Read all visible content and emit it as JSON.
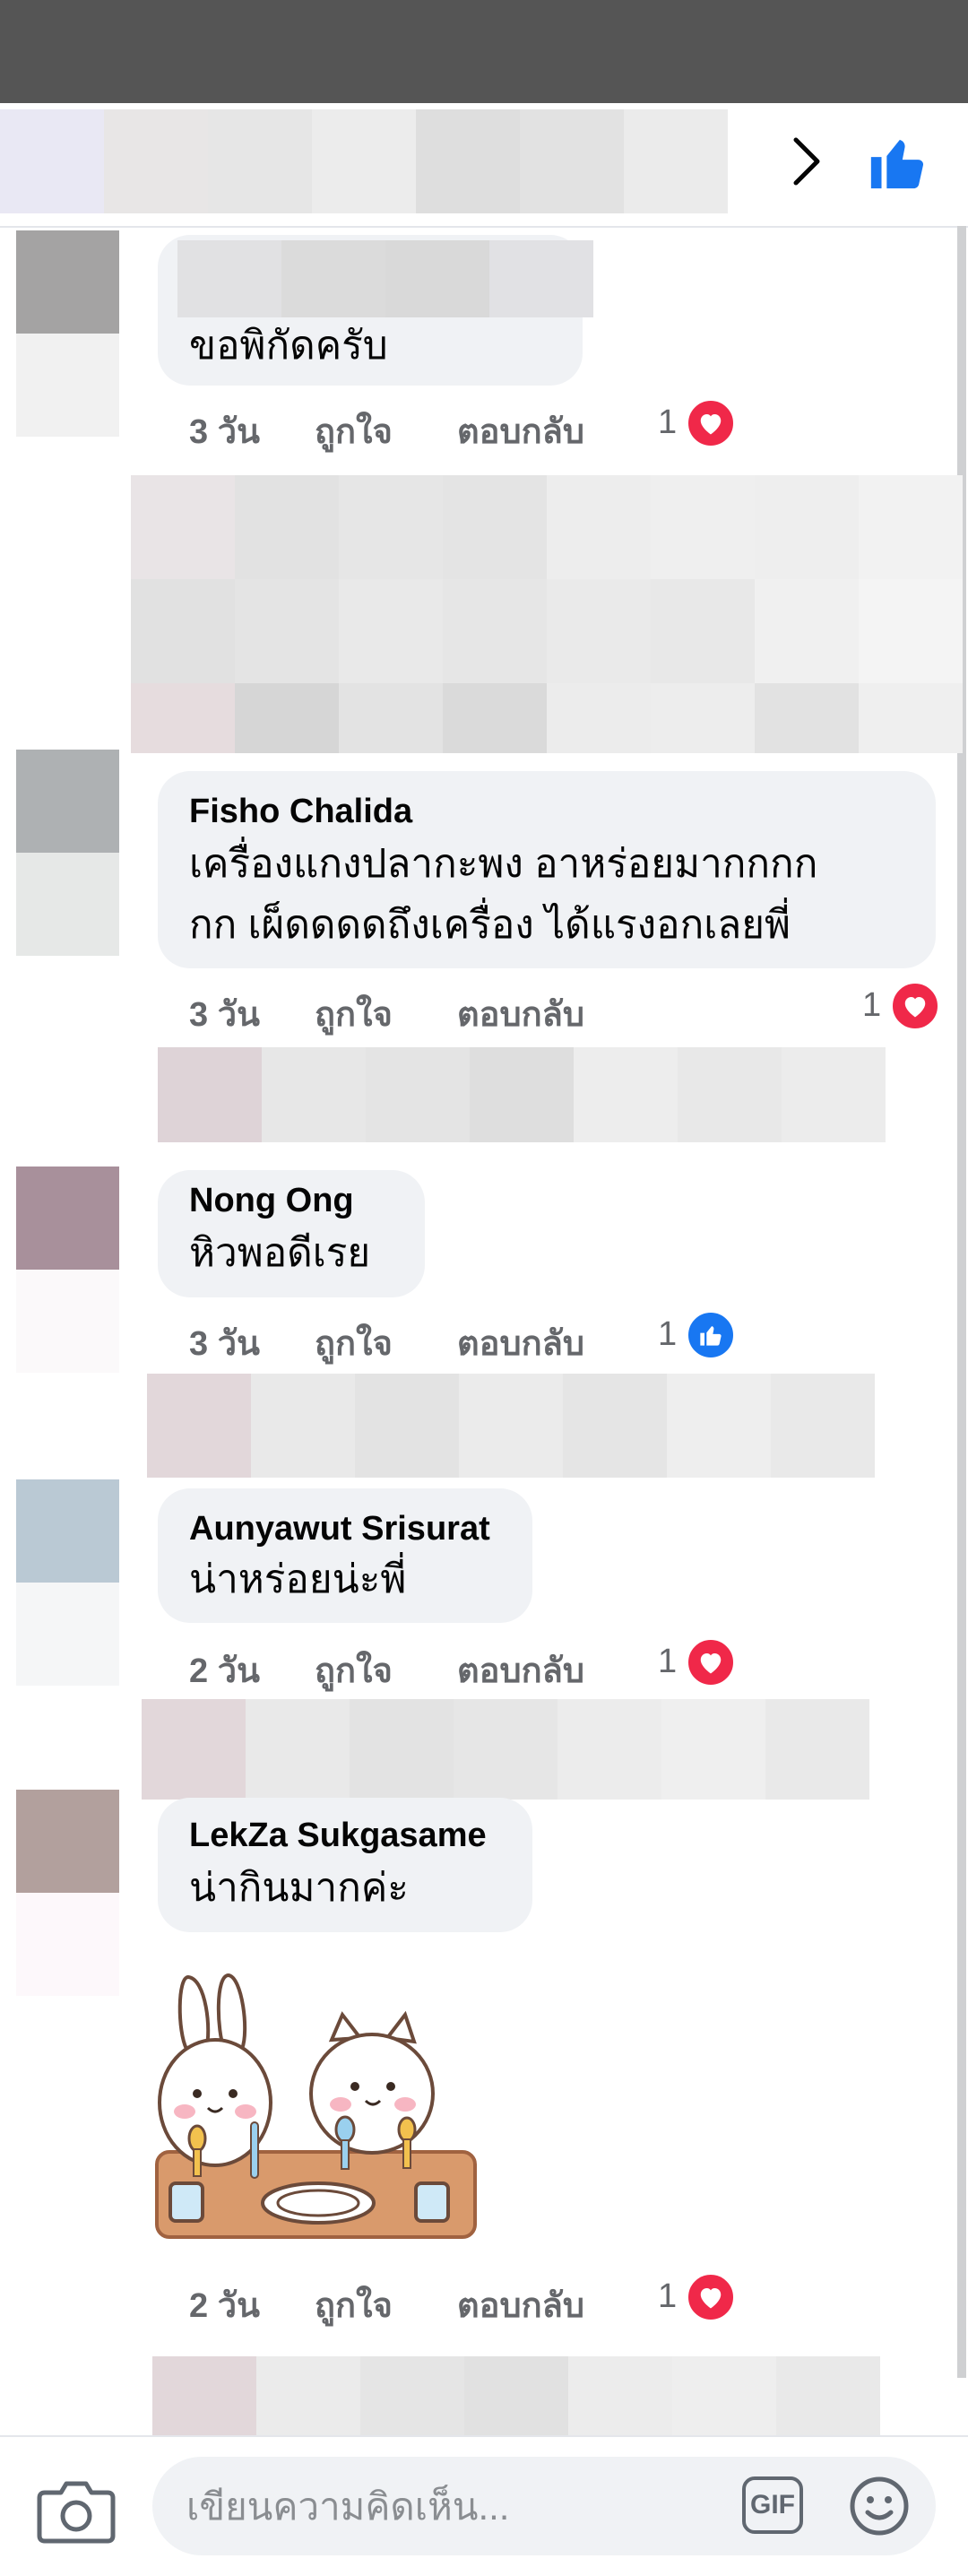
{
  "colors": {
    "accent": "#1877f2",
    "heart": "#f02849",
    "meta": "#65676b",
    "bubble": "#f0f2f5"
  },
  "header": {
    "icons": [
      "chevron-right-icon",
      "thumbs-up-icon"
    ]
  },
  "meta_labels": {
    "like": "ถูกใจ",
    "reply": "ตอบกลับ"
  },
  "comments": [
    {
      "author": "",
      "text": "ขอพิกัดครับ",
      "time": "3 วัน",
      "reaction": "heart",
      "reaction_count": "1"
    },
    {
      "author": "Fisho Chalida",
      "text": "เครื่องแกงปลากะพง  อาหร่อยมากกกก\nกก  เผ็ดดดดถึงเครื่อง  ได้แรงอกเลยพี่",
      "time": "3 วัน",
      "reaction": "heart",
      "reaction_count": "1"
    },
    {
      "author": "Nong Ong",
      "text": "หิวพอดีเรย",
      "time": "3 วัน",
      "reaction": "like",
      "reaction_count": "1"
    },
    {
      "author": "Aunyawut Srisurat",
      "text": "น่าหร่อยน่ะพี่",
      "time": "2 วัน",
      "reaction": "heart",
      "reaction_count": "1"
    },
    {
      "author": "LekZa Sukgasame",
      "text": "น่ากินมากค่ะ",
      "time": "2 วัน",
      "reaction": "heart",
      "reaction_count": "1",
      "attachment": "sticker"
    }
  ],
  "composer": {
    "placeholder": "เขียนความคิดเห็น...",
    "gif_label": "GIF",
    "icons": [
      "camera-icon",
      "emoji-icon"
    ]
  }
}
